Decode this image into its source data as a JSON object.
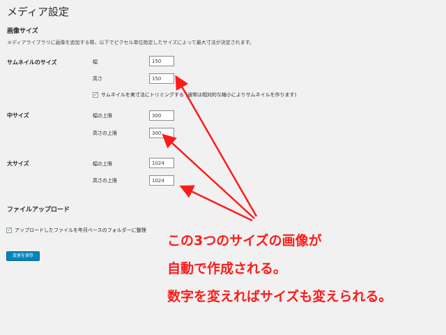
{
  "page": {
    "title": "メディア設定"
  },
  "image_sizes": {
    "heading": "画像サイズ",
    "description": "メディアライブラリに画像を追加する際、以下でピクセル単位指定したサイズによって最大寸法が決定されます。",
    "thumbnail": {
      "label": "サムネイルのサイズ",
      "width_label": "幅",
      "width_value": "150",
      "height_label": "高さ",
      "height_value": "150",
      "crop_label": "サムネイルを実寸法にトリミングする (通常は相対的な縮小によりサムネイルを作ります)",
      "crop_checked": true
    },
    "medium": {
      "label": "中サイズ",
      "max_width_label": "幅の上限",
      "max_width_value": "300",
      "max_height_label": "高さの上限",
      "max_height_value": "300"
    },
    "large": {
      "label": "大サイズ",
      "max_width_label": "幅の上限",
      "max_width_value": "1024",
      "max_height_label": "高さの上限",
      "max_height_value": "1024"
    }
  },
  "uploads": {
    "heading": "ファイルアップロード",
    "organize_label": "アップロードしたファイルを年月ベースのフォルダーに整理",
    "organize_checked": true
  },
  "buttons": {
    "save": "変更を保存"
  },
  "annotation": {
    "line1": "この3つのサイズの画像が",
    "line2": "自動で作成される。",
    "line3": "数字を変えればサイズも変えられる。",
    "color": "#ff1a1a"
  },
  "colors": {
    "background": "#f1f1f1",
    "primary_button": "#0085ba",
    "checkbox_check": "#1e8cbe"
  }
}
